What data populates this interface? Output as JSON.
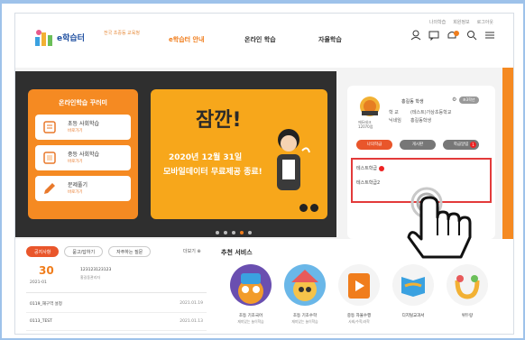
{
  "header": {
    "util_links": [
      "나의학습",
      "회원정보",
      "로그아웃"
    ],
    "logo_text": "e학습터",
    "logo_sub": "전국 초중등 교육청",
    "nav": [
      "e학습터 안내",
      "온라인 학습",
      "자율학습"
    ],
    "icons": [
      "user-icon",
      "chat-icon",
      "bell-icon",
      "search-icon",
      "menu-icon"
    ]
  },
  "hero": {
    "panel_title": "온라인학습 꾸러미",
    "menu": [
      {
        "title": "초등 사회학습",
        "sub": "바로가기"
      },
      {
        "title": "중등 사회학습",
        "sub": "바로가기"
      },
      {
        "title": "문제풀기",
        "sub": "바로가기"
      }
    ],
    "banner": {
      "headline": "잠깐!",
      "line1": "2020년 12월 31일",
      "line2": "모바일데이터 무료제공 종료!",
      "accent": "#f7a71b"
    }
  },
  "profile": {
    "name": "홍길동 학생",
    "tag": "초3학년",
    "level": [
      "에듀테크",
      "12070점"
    ],
    "school_label": "학 교",
    "school_value": "(테스트)가상초등학교",
    "parent_label": "닉네임",
    "parent_value": "홍길동학생",
    "tabs": [
      {
        "label": "나의학급",
        "count": ""
      },
      {
        "label": "게시판",
        "count": ""
      },
      {
        "label": "학급알림",
        "count": "1"
      }
    ],
    "classes": [
      "테스트학급",
      "테스트학급2"
    ]
  },
  "notice": {
    "tabs": [
      "공지사항",
      "묻고/답하기",
      "자주하는 질문"
    ],
    "more": "더보기",
    "featured": {
      "day": "30",
      "ym": "2021-01",
      "title": "123123123123",
      "sub": "홍길동관리자"
    },
    "rows": [
      {
        "title": "0119_재구역 설정",
        "date": "2021.01.19"
      },
      {
        "title": "0113_TEST",
        "date": "2021.01.13"
      }
    ]
  },
  "recommend": {
    "title": "추천 서비스",
    "items": [
      {
        "l1": "초등 기초국어",
        "l2": "재미있는 놀이학습"
      },
      {
        "l1": "초등 기초수학",
        "l2": "재미있는 놀이학습"
      },
      {
        "l1": "중등 자율수행",
        "l2": "사회/수학/과학"
      },
      {
        "l1": "디지털교과서",
        "l2": ""
      },
      {
        "l1": "위두랑",
        "l2": ""
      }
    ]
  },
  "colors": {
    "accent": "#f07d1c",
    "highlight_border": "#e33a3a",
    "panel": "#f58a22"
  }
}
